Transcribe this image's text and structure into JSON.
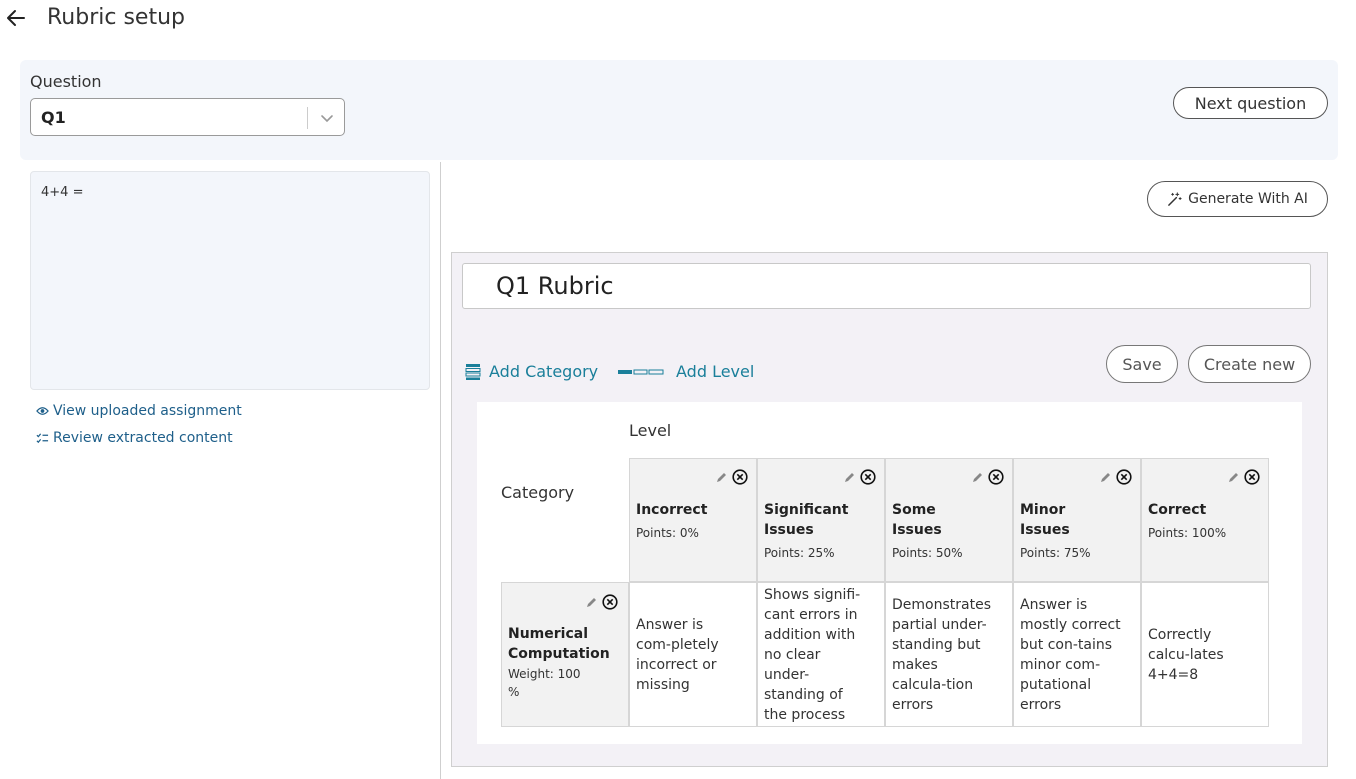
{
  "header": {
    "title": "Rubric setup"
  },
  "question": {
    "label": "Question",
    "selected": "Q1",
    "next_label": "Next question",
    "text": "4+4 ="
  },
  "links": {
    "view_uploaded": "View uploaded assignment",
    "review_extracted": "Review extracted content"
  },
  "rubric": {
    "generate_label": "Generate With AI",
    "title": "Q1 Rubric",
    "add_category_label": "Add Category",
    "add_level_label": "Add Level",
    "save_label": "Save",
    "create_new_label": "Create new",
    "level_heading": "Level",
    "category_heading": "Category",
    "levels": [
      {
        "name": "Incorrect",
        "points": "Points: 0%"
      },
      {
        "name": "Significant Issues",
        "points": "Points: 25%"
      },
      {
        "name": "Some Issues",
        "points": "Points: 50%"
      },
      {
        "name": "Minor Issues",
        "points": "Points: 75%"
      },
      {
        "name": "Correct",
        "points": "Points: 100%"
      }
    ],
    "categories": [
      {
        "name": "Numerical Computation",
        "weight": "Weight: 100 %",
        "descriptions": [
          "Answer is com-pletely incorrect or missing",
          "Shows signifi-cant errors in addition with no clear under-standing of the process",
          "Demonstrates partial under-standing but makes calcula-tion errors",
          "Answer is mostly correct but con-tains minor com-putational errors",
          "Correctly calcu-lates 4+4=8"
        ]
      }
    ]
  },
  "colors": {
    "accent": "#1a7f9a",
    "link": "#1e5f8a",
    "panel_bg": "#f3f6fb",
    "rubric_bg": "#f3f1f6",
    "header_cell_bg": "#f2f2f2"
  }
}
